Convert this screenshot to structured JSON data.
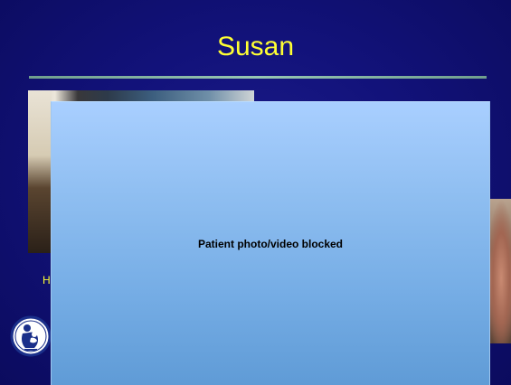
{
  "slide": {
    "title": "Susan",
    "caption_fragment": "H",
    "blocked_message": "Patient photo/video blocked"
  },
  "icons": {
    "logo": "mother-and-child-logo-icon"
  },
  "colors": {
    "background": "#12127a",
    "title": "#ffff33",
    "rule": "#97c6b4",
    "overlay_top": "#a9cfff",
    "overlay_bottom": "#5f9bd6"
  }
}
